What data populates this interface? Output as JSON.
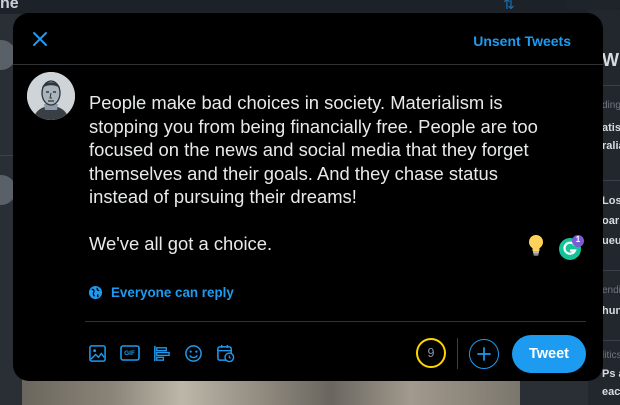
{
  "background": {
    "left_fragment": "ne",
    "right_heading": "Wha",
    "right_items": [
      {
        "text": "ding yo",
        "style": "muted"
      },
      {
        "text": "atist",
        "style": "bold"
      },
      {
        "text": "ralia",
        "style": "bold"
      },
      {
        "text": "Los",
        "style": "bold"
      },
      {
        "text": "oar",
        "style": "bold"
      },
      {
        "text": "ueu",
        "style": "bold"
      },
      {
        "text": "endi",
        "style": "muted"
      },
      {
        "text": "hun",
        "style": "bold"
      },
      {
        "text": "litics",
        "style": "muted"
      },
      {
        "text": "Ps a",
        "style": "bold"
      },
      {
        "text": "each",
        "style": "bold"
      }
    ]
  },
  "modal": {
    "close_icon": "close-x-icon",
    "unsent_label": "Unsent Tweets",
    "tweet_text": "People make bad choices in society. Materialism is\nstopping you from being financially free. People are too\nfocused on the news and social media that they forget\nthemselves and their goals. And they chase status\ninstead of pursuing their dreams!\n\nWe've all got a choice.",
    "grammarly_badge": "1",
    "reply_setting": "Everyone can reply",
    "toolbar_icons": [
      "image-icon",
      "gif-icon",
      "poll-icon",
      "emoji-icon",
      "schedule-icon"
    ],
    "gif_label": "GIF",
    "char_counter": "9",
    "tweet_button": "Tweet"
  },
  "colors": {
    "accent": "#1d9bf0",
    "modal_bg": "#000000",
    "text": "#e7e9ea",
    "counter_ring": "#ffd400",
    "grammarly": "#15c39a",
    "badge": "#7b5cd6"
  }
}
